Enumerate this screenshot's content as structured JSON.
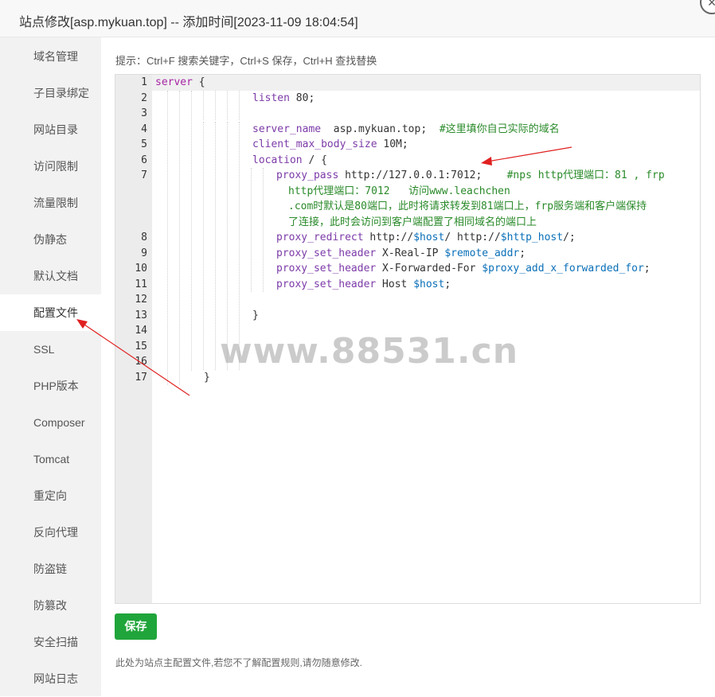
{
  "window": {
    "title": "站点修改[asp.mykuan.top] -- 添加时间[2023-11-09 18:04:54]",
    "close_glyph": "×"
  },
  "sidebar": {
    "items": [
      {
        "label": "域名管理"
      },
      {
        "label": "子目录绑定"
      },
      {
        "label": "网站目录"
      },
      {
        "label": "访问限制"
      },
      {
        "label": "流量限制"
      },
      {
        "label": "伪静态"
      },
      {
        "label": "默认文档"
      },
      {
        "label": "配置文件",
        "active": true
      },
      {
        "label": "SSL"
      },
      {
        "label": "PHP版本"
      },
      {
        "label": "Composer"
      },
      {
        "label": "Tomcat"
      },
      {
        "label": "重定向"
      },
      {
        "label": "反向代理"
      },
      {
        "label": "防盗链"
      },
      {
        "label": "防篡改"
      },
      {
        "label": "安全扫描"
      },
      {
        "label": "网站日志"
      }
    ]
  },
  "main": {
    "hint": "提示：Ctrl+F 搜索关键字，Ctrl+S 保存，Ctrl+H 查找替换",
    "editor": {
      "line_numbers": [
        "1",
        "2",
        "3",
        "4",
        "5",
        "6",
        "7",
        "8",
        "9",
        "10",
        "11",
        "12",
        "13",
        "14",
        "15",
        "16",
        "17"
      ],
      "l1_kw": "server",
      "l1_rest": " {",
      "l2_dir": "listen",
      "l2_rest": " 80;",
      "l4_dir": "server_name",
      "l4_rest": "  asp.mykuan.top;  ",
      "l4_comment": "#这里填你自己实际的域名",
      "l5_dir": "client_max_body_size",
      "l5_rest": " 10M;",
      "l6_dir": "location",
      "l6_rest": " / {",
      "l7_dir": "proxy_pass",
      "l7_rest": " http://127.0.0.1:7012;    ",
      "l7_comment_1": "#nps http代理端口：81 , frp",
      "l7_comment_2": "http代理端口：7012   访问www.leachchen",
      "l7_comment_3": ".com时默认是80端口，此时将请求转发到81端口上，frp服务端和客户端保持",
      "l7_comment_4": "了连接，此时会访问到客户端配置了相同域名的端口上",
      "l8_dir": "proxy_redirect",
      "l8_a": " http://",
      "l8_v1": "$host",
      "l8_b": "/ http://",
      "l8_v2": "$http_host",
      "l8_c": "/;",
      "l9_dir": "proxy_set_header",
      "l9_a": " X-Real-IP ",
      "l9_v": "$remote_addr",
      "l9_c": ";",
      "l10_dir": "proxy_set_header",
      "l10_a": " X-Forwarded-For ",
      "l10_v": "$proxy_add_x_forwarded_for",
      "l10_c": ";",
      "l11_dir": "proxy_set_header",
      "l11_a": " Host ",
      "l11_v": "$host",
      "l11_c": ";",
      "l13": "}",
      "l17": "}"
    },
    "watermark": "www.88531.cn",
    "save_label": "保存",
    "footer_note": "此处为站点主配置文件,若您不了解配置规则,请勿随意修改."
  },
  "colors": {
    "accent_green": "#20a53a",
    "arrow_red": "#e02020",
    "keyword": "#a626a4",
    "variable": "#0a6fb8",
    "comment": "#2a8a2a"
  }
}
